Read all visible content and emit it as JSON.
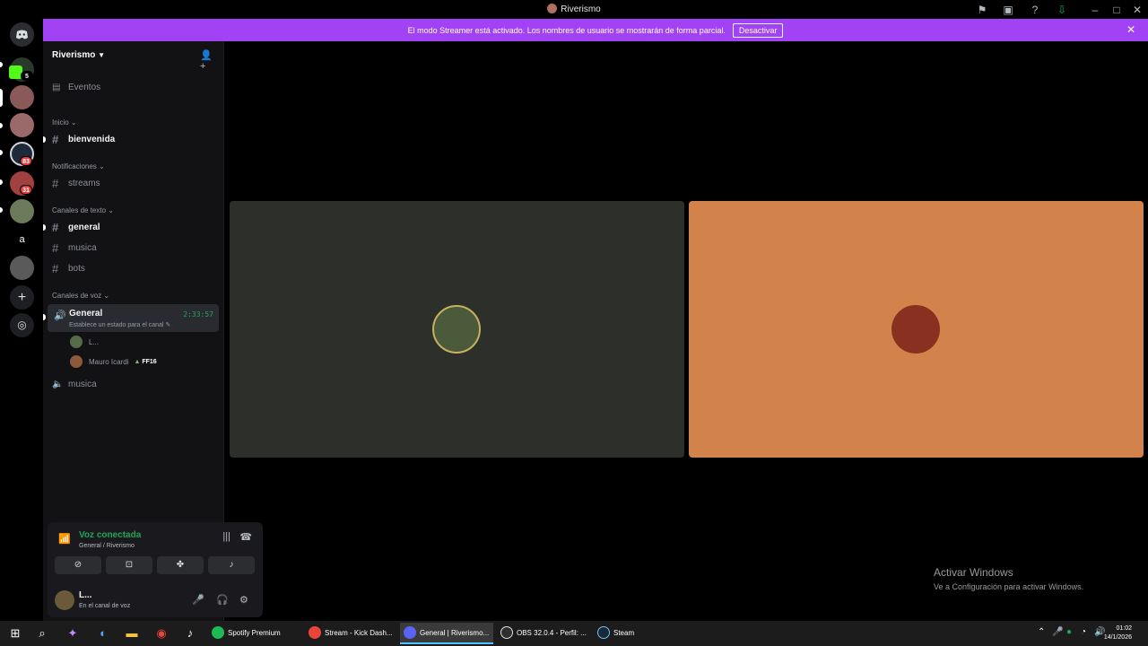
{
  "window": {
    "title": "Riverismo"
  },
  "banner": {
    "text": "El modo Streamer está activado. Los nombres de usuario se mostrarán de forma parcial.",
    "button": "Desactivar"
  },
  "rail": {
    "badges": [
      "5",
      "83",
      "31"
    ],
    "letter": "a"
  },
  "server": {
    "name": "Riverismo",
    "events": "Eventos",
    "categories": {
      "inicio": "Inicio",
      "notificaciones": "Notificaciones",
      "texto": "Canales de texto",
      "voz": "Canales de voz"
    },
    "channels": {
      "bienvenida": "bienvenida",
      "streams": "streams",
      "general": "general",
      "musica": "musica",
      "bots": "bots"
    },
    "voice": {
      "general": "General",
      "timer": "2:33:57",
      "status": "Establece un estado para el canal",
      "users": [
        {
          "name": "L...",
          "tag": ""
        },
        {
          "name": "Mauro Icardi",
          "tag": "FF16"
        }
      ],
      "musica": "musica"
    }
  },
  "panel": {
    "voice_connected": "Voz conectada",
    "location": "General / Riverismo",
    "user_name": "L...",
    "user_status": "En el canal de voz"
  },
  "watermark": {
    "line1": "Activar Windows",
    "line2": "Ve a Configuración para activar Windows."
  },
  "taskbar": {
    "apps": [
      "Spotify Premium",
      "Stream - Kick Dash...",
      "General | Riverismo...",
      "OBS 32.0.4 - Perfil: ...",
      "Steam"
    ],
    "time": "01:02",
    "date": "14/1/2026"
  },
  "colors": {
    "accent": "#a142f4",
    "voice_green": "#23a55a",
    "tile_left": "#2d2f2a",
    "tile_right": "#d2834c"
  }
}
